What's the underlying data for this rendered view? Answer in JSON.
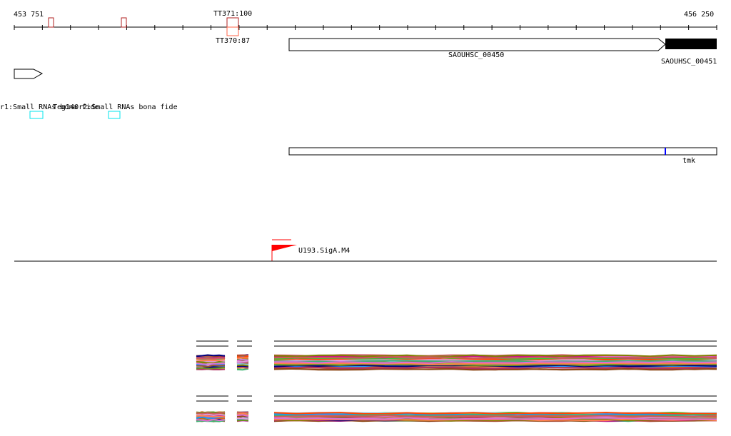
{
  "ruler": {
    "start_label": "453 751",
    "end_label": "456 250"
  },
  "terminators": {
    "top": "TT371:100",
    "bottom": "TT370:87"
  },
  "genes": [
    {
      "name": "SAOUHSC_00450"
    },
    {
      "name": "SAOUHSC_00451"
    }
  ],
  "rna_labels": [
    "r1:Small RNAs bona fide",
    "Teg140r2:Small RNAs bona fide"
  ],
  "operon": {
    "name": "tmk"
  },
  "promoter": {
    "name": "U193.SigA.M4"
  },
  "colors": {
    "terminator": "#b22222",
    "terminator_alt": "#ff6347",
    "rna": "#00e5ee",
    "operon_mark": "#0000ff",
    "promoter": "#ff0000"
  },
  "trace_colors": [
    "#6b8e23",
    "#cd5c5c",
    "#ff7f50",
    "#da70d6",
    "#8b4513",
    "#d2691e",
    "#32cd32",
    "#9acd32",
    "#b03060",
    "#87ceeb",
    "#1e90ff",
    "#000080",
    "#ff4500",
    "#c71585",
    "#808000",
    "#a0522d",
    "#dda0dd",
    "#3cb371"
  ]
}
